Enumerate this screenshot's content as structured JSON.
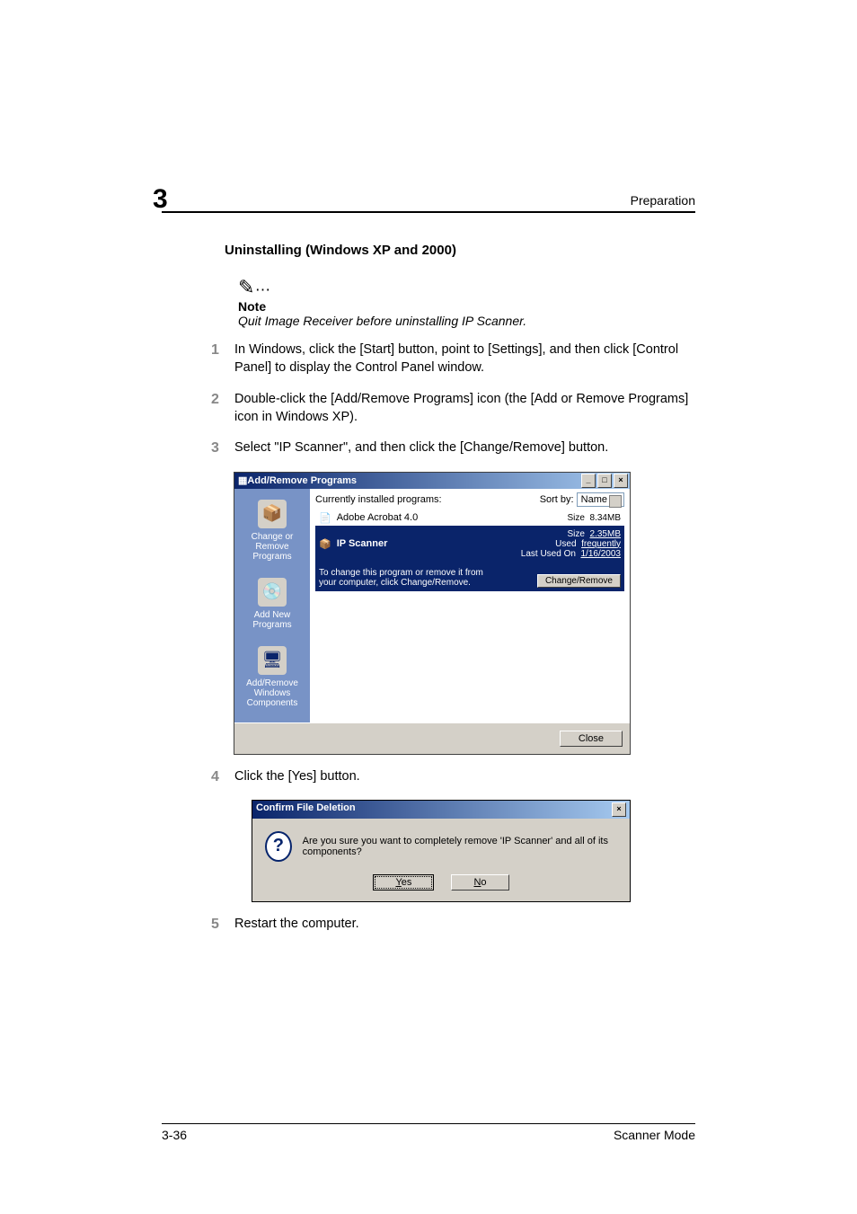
{
  "chapter": "3",
  "header": {
    "right": "Preparation"
  },
  "section_title": "Uninstalling (Windows XP and 2000)",
  "note": {
    "label": "Note",
    "text": "Quit Image Receiver before uninstalling IP Scanner."
  },
  "steps": [
    {
      "n": "1",
      "text": "In Windows, click the [Start] button, point to [Settings], and then click [Control Panel] to display the Control Panel window."
    },
    {
      "n": "2",
      "text": "Double-click the [Add/Remove Programs] icon (the [Add or Remove Programs] icon in Windows XP)."
    },
    {
      "n": "3",
      "text": "Select \"IP Scanner\", and then click the [Change/Remove] button."
    },
    {
      "n": "4",
      "text": "Click the [Yes] button."
    },
    {
      "n": "5",
      "text": "Restart the computer."
    }
  ],
  "arp_window": {
    "title": "Add/Remove Programs",
    "sidebar": [
      {
        "label": "Change or Remove Programs"
      },
      {
        "label": "Add New Programs"
      },
      {
        "label": "Add/Remove Windows Components"
      }
    ],
    "header": {
      "label": "Currently installed programs:",
      "sort_label": "Sort by:",
      "sort_value": "Name"
    },
    "programs": [
      {
        "name": "Adobe Acrobat 4.0",
        "size_label": "Size",
        "size": "8.34MB"
      },
      {
        "name": "IP Scanner",
        "size_label": "Size",
        "size": "2.35MB",
        "used_label": "Used",
        "used": "frequently",
        "last_label": "Last Used On",
        "last": "1/16/2003",
        "desc": "To change this program or remove it from your computer, click Change/Remove.",
        "change_remove": "Change/Remove"
      }
    ],
    "close": "Close"
  },
  "confirm_dialog": {
    "title": "Confirm File Deletion",
    "text": "Are you sure you want to completely remove 'IP Scanner' and all of its components?",
    "yes": "Yes",
    "no": "No"
  },
  "footer": {
    "left": "3-36",
    "right": "Scanner Mode"
  }
}
